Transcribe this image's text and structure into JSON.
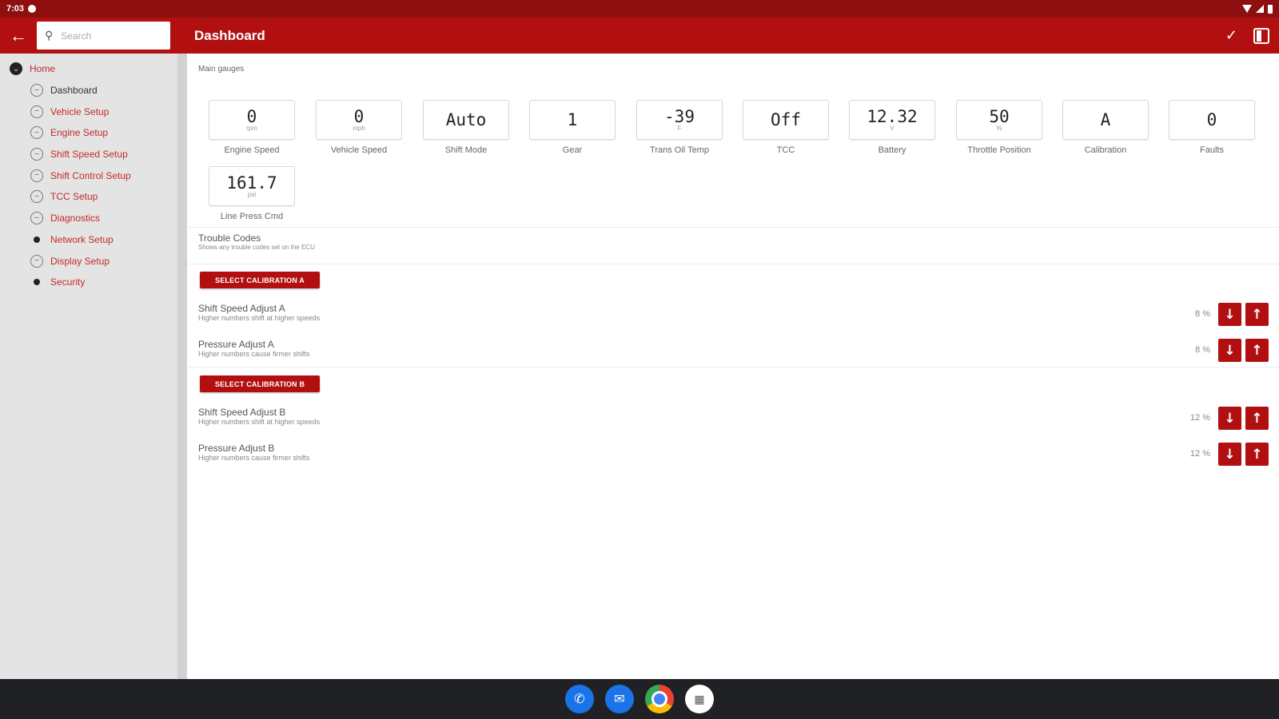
{
  "status": {
    "time": "7:03"
  },
  "appbar": {
    "title": "Dashboard",
    "search_placeholder": "Search"
  },
  "sidebar": {
    "home": "Home",
    "items": [
      {
        "label": "Dashboard",
        "icon": "ring",
        "current": true
      },
      {
        "label": "Vehicle Setup",
        "icon": "ring"
      },
      {
        "label": "Engine Setup",
        "icon": "ring"
      },
      {
        "label": "Shift Speed Setup",
        "icon": "ring"
      },
      {
        "label": "Shift Control Setup",
        "icon": "ring"
      },
      {
        "label": "TCC Setup",
        "icon": "ring"
      },
      {
        "label": "Diagnostics",
        "icon": "ring"
      },
      {
        "label": "Network Setup",
        "icon": "dot"
      },
      {
        "label": "Display Setup",
        "icon": "ring"
      },
      {
        "label": "Security",
        "icon": "dot"
      }
    ]
  },
  "main": {
    "section_label": "Main gauges",
    "gauges": [
      {
        "value": "0",
        "unit": "rpm",
        "label": "Engine Speed"
      },
      {
        "value": "0",
        "unit": "mph",
        "label": "Vehicle Speed"
      },
      {
        "value": "Auto",
        "unit": "",
        "label": "Shift Mode"
      },
      {
        "value": "1",
        "unit": "",
        "label": "Gear"
      },
      {
        "value": "-39",
        "unit": "F",
        "label": "Trans Oil Temp"
      },
      {
        "value": "Off",
        "unit": "",
        "label": "TCC"
      },
      {
        "value": "12.32",
        "unit": "V",
        "label": "Battery"
      },
      {
        "value": "50",
        "unit": "%",
        "label": "Throttle Position"
      },
      {
        "value": "A",
        "unit": "",
        "label": "Calibration"
      },
      {
        "value": "0",
        "unit": "",
        "label": "Faults"
      },
      {
        "value": "161.7",
        "unit": "psi",
        "label": "Line Press Cmd"
      }
    ],
    "trouble_codes": {
      "title": "Trouble Codes",
      "subtitle": "Shows any trouble codes set on the ECU"
    },
    "cal_a": {
      "button": "Select Calibration A",
      "rows": [
        {
          "title": "Shift Speed Adjust A",
          "subtitle": "Higher numbers shift at higher speeds",
          "value": "8 %"
        },
        {
          "title": "Pressure Adjust A",
          "subtitle": "Higher numbers cause firmer shifts",
          "value": "8 %"
        }
      ]
    },
    "cal_b": {
      "button": "Select Calibration B",
      "rows": [
        {
          "title": "Shift Speed Adjust B",
          "subtitle": "Higher numbers shift at higher speeds",
          "value": "12 %"
        },
        {
          "title": "Pressure Adjust B",
          "subtitle": "Higher numbers cause firmer shifts",
          "value": "12 %"
        }
      ]
    }
  },
  "icons": {
    "back": "arrow-left-icon",
    "search": "search-icon",
    "check": "check-icon",
    "panel": "side-panel-icon",
    "down": "arrow-down-icon",
    "up": "arrow-up-icon"
  },
  "colors": {
    "accent": "#b21010",
    "statusbar": "#8e0f0f",
    "sidebar": "#e4e4e4",
    "nav_text": "#c42a2a",
    "taskbar": "#202124"
  }
}
